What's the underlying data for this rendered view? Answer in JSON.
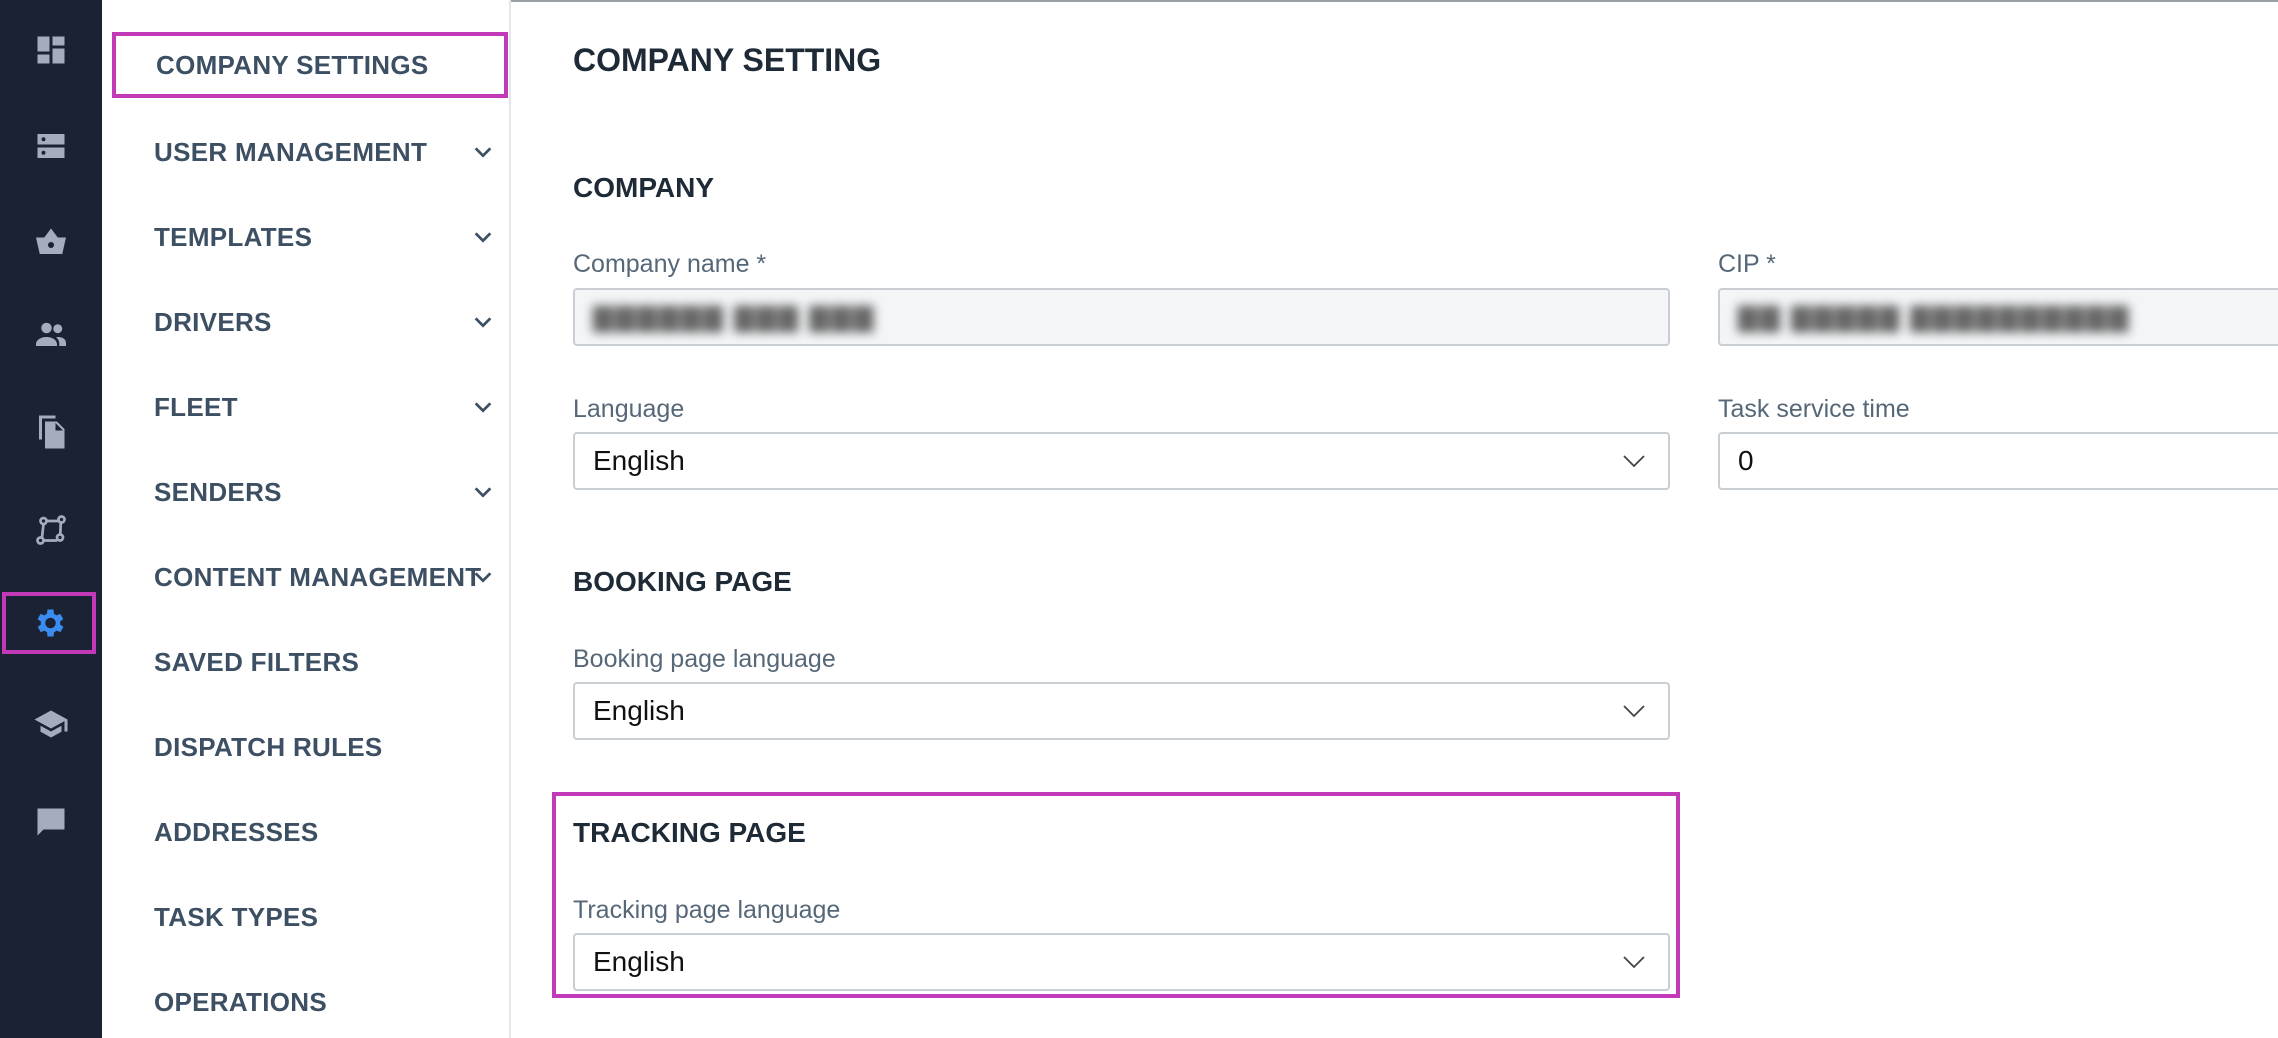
{
  "rail": {
    "icons": [
      "dashboard-icon",
      "storage-icon",
      "basket-icon",
      "people-icon",
      "documents-icon",
      "routes-icon",
      "gear-icon",
      "school-icon",
      "chat-icon"
    ],
    "active_icon": "gear-icon"
  },
  "sidebar": {
    "items": [
      {
        "label": "COMPANY SETTINGS",
        "expandable": false,
        "selected": true
      },
      {
        "label": "USER MANAGEMENT",
        "expandable": true
      },
      {
        "label": "TEMPLATES",
        "expandable": true
      },
      {
        "label": "DRIVERS",
        "expandable": true
      },
      {
        "label": "FLEET",
        "expandable": true
      },
      {
        "label": "SENDERS",
        "expandable": true
      },
      {
        "label": "CONTENT MANAGEMENT",
        "expandable": true
      },
      {
        "label": "SAVED FILTERS",
        "expandable": false
      },
      {
        "label": "DISPATCH RULES",
        "expandable": false
      },
      {
        "label": "ADDRESSES",
        "expandable": false
      },
      {
        "label": "TASK TYPES",
        "expandable": false
      },
      {
        "label": "OPERATIONS",
        "expandable": false
      }
    ]
  },
  "main": {
    "title": "COMPANY SETTING",
    "company": {
      "section_title": "COMPANY",
      "company_name_label": "Company name *",
      "company_name_value": "",
      "cip_label": "CIP *",
      "cip_value": "",
      "language_label": "Language",
      "language_value": "English",
      "task_service_time_label": "Task service time",
      "task_service_time_value": "0"
    },
    "booking": {
      "section_title": "BOOKING PAGE",
      "language_label": "Booking page language",
      "language_value": "English"
    },
    "tracking": {
      "section_title": "TRACKING PAGE",
      "language_label": "Tracking page language",
      "language_value": "English"
    }
  },
  "colors": {
    "rail_bg": "#1b2233",
    "rail_icon": "#a3adbb",
    "active_icon": "#3b8cf0",
    "highlight": "#c23ab8",
    "sidebar_text": "#3d4f63"
  }
}
